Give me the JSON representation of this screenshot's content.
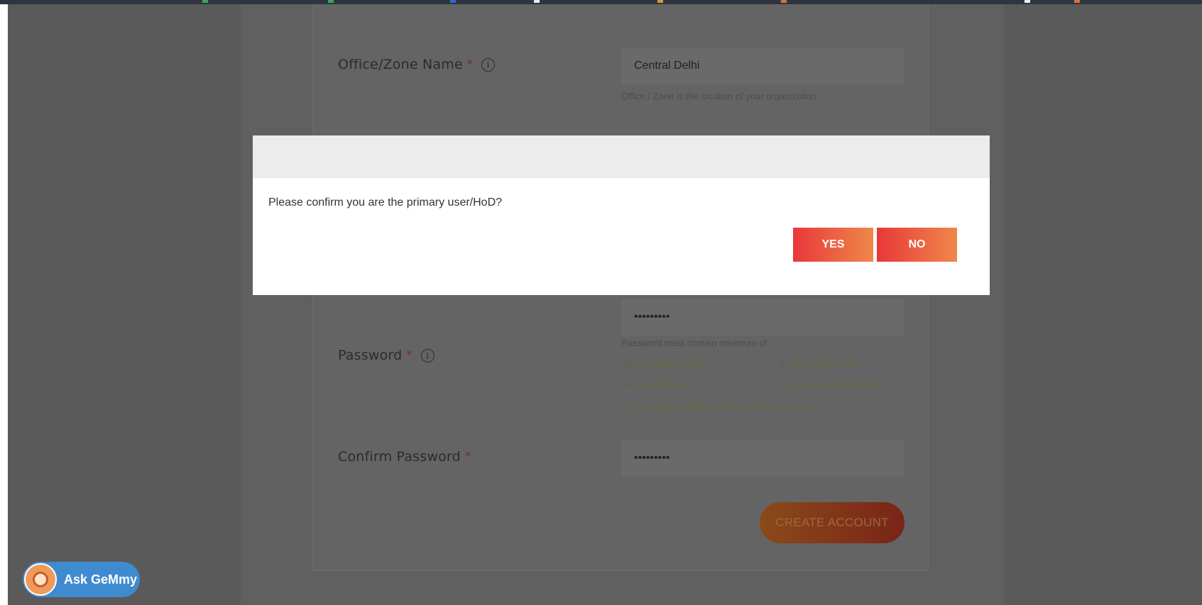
{
  "form": {
    "office_zone_label": "Office/Zone Name",
    "office_zone_required": "*",
    "office_zone_value": "Central Delhi",
    "office_zone_hint": "Office / Zone is the location of your organization.",
    "password_label": "Password",
    "password_required": "*",
    "password_value": "•••••••••",
    "password_hint": "Password must contain minimum of",
    "rules": [
      "One Upper Case",
      "One Lower Case",
      "One Numeric",
      "One Special Character",
      "8 characters and maximum of 16 characters"
    ],
    "confirm_password_label": "Confirm Password",
    "confirm_password_required": "*",
    "confirm_password_value": "•••••••••",
    "create_account_label": "CREATE ACCOUNT",
    "info_glyph": "i"
  },
  "modal": {
    "message": "Please confirm you are the primary user/HoD?",
    "yes_label": "YES",
    "no_label": "NO"
  },
  "chat": {
    "label": "Ask GeMmy"
  },
  "colors": {
    "overlay": "#5a5a5a",
    "modal_header": "#ececec",
    "button_gradient_start": "#e8383a",
    "button_gradient_end": "#f0874a",
    "chat_button": "#3f8bd0"
  }
}
